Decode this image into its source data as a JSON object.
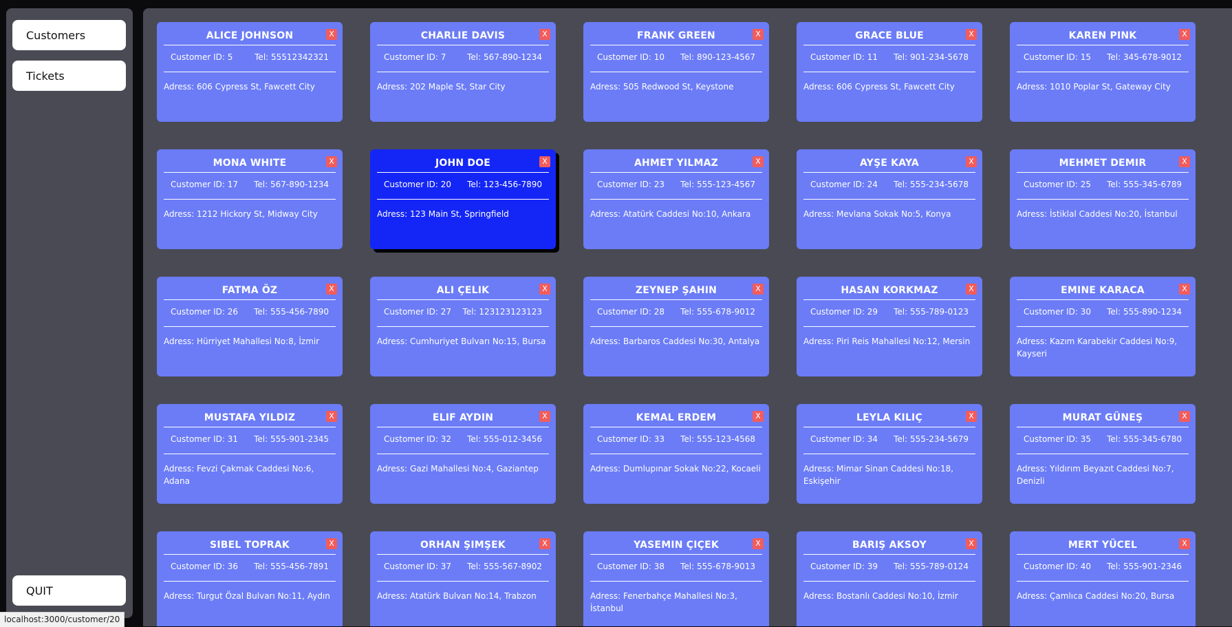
{
  "sidebar": {
    "nav": [
      {
        "label": "Customers"
      },
      {
        "label": "Tickets"
      }
    ],
    "quit_label": "QUIT"
  },
  "close_label": "X",
  "customers": [
    {
      "name": "ALICE JOHNSON",
      "id": "Customer ID: 5",
      "tel": "Tel: 55512342321",
      "address": "Adress: 606 Cypress St, Fawcett City"
    },
    {
      "name": "CHARLIE DAVIS",
      "id": "Customer ID: 7",
      "tel": "Tel: 567-890-1234",
      "address": "Adress: 202 Maple St, Star City"
    },
    {
      "name": "FRANK GREEN",
      "id": "Customer ID: 10",
      "tel": "Tel: 890-123-4567",
      "address": "Adress: 505 Redwood St, Keystone"
    },
    {
      "name": "GRACE BLUE",
      "id": "Customer ID: 11",
      "tel": "Tel: 901-234-5678",
      "address": "Adress: 606 Cypress St, Fawcett City"
    },
    {
      "name": "KAREN PINK",
      "id": "Customer ID: 15",
      "tel": "Tel: 345-678-9012",
      "address": "Adress: 1010 Poplar St, Gateway City"
    },
    {
      "name": "MONA WHITE",
      "id": "Customer ID: 17",
      "tel": "Tel: 567-890-1234",
      "address": "Adress: 1212 Hickory St, Midway City"
    },
    {
      "name": "JOHN DOE",
      "id": "Customer ID: 20",
      "tel": "Tel: 123-456-7890",
      "address": "Adress: 123 Main St, Springfield",
      "selected": true
    },
    {
      "name": "AHMET YILMAZ",
      "id": "Customer ID: 23",
      "tel": "Tel: 555-123-4567",
      "address": "Adress: Atatürk Caddesi No:10, Ankara"
    },
    {
      "name": "AYŞE KAYA",
      "id": "Customer ID: 24",
      "tel": "Tel: 555-234-5678",
      "address": "Adress: Mevlana Sokak No:5, Konya"
    },
    {
      "name": "MEHMET DEMIR",
      "id": "Customer ID: 25",
      "tel": "Tel: 555-345-6789",
      "address": "Adress: İstiklal Caddesi No:20, İstanbul"
    },
    {
      "name": "FATMA ÖZ",
      "id": "Customer ID: 26",
      "tel": "Tel: 555-456-7890",
      "address": "Adress: Hürriyet Mahallesi No:8, İzmir"
    },
    {
      "name": "ALI ÇELIK",
      "id": "Customer ID: 27",
      "tel": "Tel: 123123123123",
      "address": "Adress: Cumhuriyet Bulvarı No:15, Bursa"
    },
    {
      "name": "ZEYNEP ŞAHIN",
      "id": "Customer ID: 28",
      "tel": "Tel: 555-678-9012",
      "address": "Adress: Barbaros Caddesi No:30, Antalya"
    },
    {
      "name": "HASAN KORKMAZ",
      "id": "Customer ID: 29",
      "tel": "Tel: 555-789-0123",
      "address": "Adress: Piri Reis Mahallesi No:12, Mersin"
    },
    {
      "name": "EMINE KARACA",
      "id": "Customer ID: 30",
      "tel": "Tel: 555-890-1234",
      "address": "Adress: Kazım Karabekir Caddesi No:9, Kayseri"
    },
    {
      "name": "MUSTAFA YILDIZ",
      "id": "Customer ID: 31",
      "tel": "Tel: 555-901-2345",
      "address": "Adress: Fevzi Çakmak Caddesi No:6, Adana"
    },
    {
      "name": "ELIF AYDIN",
      "id": "Customer ID: 32",
      "tel": "Tel: 555-012-3456",
      "address": "Adress: Gazi Mahallesi No:4, Gaziantep"
    },
    {
      "name": "KEMAL ERDEM",
      "id": "Customer ID: 33",
      "tel": "Tel: 555-123-4568",
      "address": "Adress: Dumlupınar Sokak No:22, Kocaeli"
    },
    {
      "name": "LEYLA KILIÇ",
      "id": "Customer ID: 34",
      "tel": "Tel: 555-234-5679",
      "address": "Adress: Mimar Sinan Caddesi No:18, Eskişehir"
    },
    {
      "name": "MURAT GÜNEŞ",
      "id": "Customer ID: 35",
      "tel": "Tel: 555-345-6780",
      "address": "Adress: Yıldırım Beyazıt Caddesi No:7, Denizli"
    },
    {
      "name": "SIBEL TOPRAK",
      "id": "Customer ID: 36",
      "tel": "Tel: 555-456-7891",
      "address": "Adress: Turgut Özal Bulvarı No:11, Aydın"
    },
    {
      "name": "ORHAN ŞIMŞEK",
      "id": "Customer ID: 37",
      "tel": "Tel: 555-567-8902",
      "address": "Adress: Atatürk Bulvarı No:14, Trabzon"
    },
    {
      "name": "YASEMIN ÇIÇEK",
      "id": "Customer ID: 38",
      "tel": "Tel: 555-678-9013",
      "address": "Adress: Fenerbahçe Mahallesi No:3, İstanbul"
    },
    {
      "name": "BARIŞ AKSOY",
      "id": "Customer ID: 39",
      "tel": "Tel: 555-789-0124",
      "address": "Adress: Bostanlı Caddesi No:10, İzmir"
    },
    {
      "name": "MERT YÜCEL",
      "id": "Customer ID: 40",
      "tel": "Tel: 555-901-2346",
      "address": "Adress: Çamlıca Caddesi No:20, Bursa"
    }
  ],
  "status_bar": {
    "url": "localhost:3000/customer/20"
  }
}
